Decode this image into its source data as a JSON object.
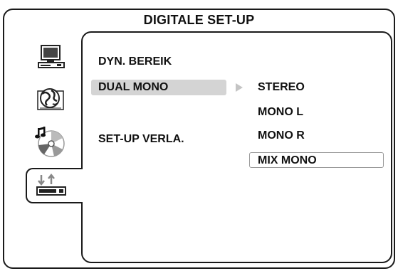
{
  "window": {
    "title": "DIGITALE SET-UP"
  },
  "sidebar": {
    "icons": [
      {
        "icon": "monitor-icon"
      },
      {
        "icon": "language-globe-icon"
      },
      {
        "icon": "audio-disc-icon"
      },
      {
        "icon": "digital-setup-icon",
        "selected": true
      }
    ]
  },
  "menu": {
    "items": [
      {
        "label": "DYN. BEREIK"
      },
      {
        "label": "DUAL MONO",
        "highlighted": true
      },
      {
        "label": "SET-UP VERLA."
      }
    ]
  },
  "submenu": {
    "options": [
      {
        "label": "STEREO"
      },
      {
        "label": "MONO L"
      },
      {
        "label": "MONO R"
      },
      {
        "label": "MIX MONO",
        "selected": true
      }
    ]
  },
  "colors": {
    "highlight": "#d4d4d4",
    "border": "#1a1a1a",
    "background": "#ffffff"
  }
}
